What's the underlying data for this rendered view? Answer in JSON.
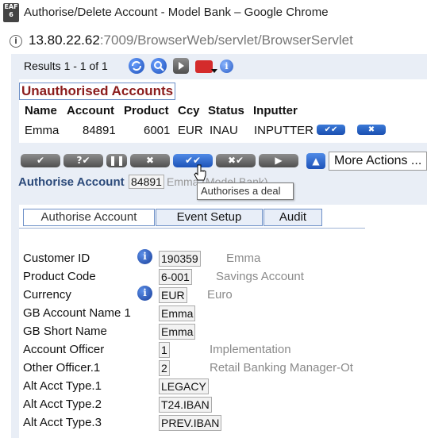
{
  "window": {
    "app_icon_text": [
      "EAF",
      "6"
    ],
    "title": "Authorise/Delete Account - Model Bank – Google Chrome",
    "url_host": "13.80.22.62",
    "url_rest": ":7009/BrowserWeb/servlet/BrowserServlet"
  },
  "toolbar": {
    "results": "Results 1 - 1 of 1"
  },
  "unauthorised": {
    "title": "Unauthorised Accounts",
    "headers": [
      "Name",
      "Account",
      "Product",
      "Ccy",
      "Status",
      "Inputter"
    ],
    "row": [
      "Emma",
      "84891",
      "6001",
      "EUR",
      "INAU",
      "INPUTTER"
    ]
  },
  "actions": {
    "buttons": [
      "✔",
      "?✔",
      "❚❚",
      "✖",
      "✔✔",
      "✖✔",
      "▶"
    ],
    "more_actions": "More Actions ..."
  },
  "record": {
    "label": "Authorise Account",
    "value": "84891",
    "desc": "Emma (Model Bank)",
    "tooltip": "Authorises a deal"
  },
  "tabs": [
    "Authorise Account",
    "Event Setup",
    "Audit"
  ],
  "fields": [
    {
      "label": "Customer ID",
      "value": "190359",
      "desc": "Emma"
    },
    {
      "label": "Product Code",
      "value": "6-001",
      "desc": "Savings Account"
    },
    {
      "label": "Currency",
      "value": "EUR",
      "desc": "Euro"
    },
    {
      "label": "GB Account Name 1",
      "value": "Emma",
      "desc": ""
    },
    {
      "label": "GB Short Name",
      "value": "Emma",
      "desc": ""
    },
    {
      "label": "Account Officer",
      "value": "1",
      "desc": "Implementation"
    },
    {
      "label": "Other Officer.1",
      "value": "2",
      "desc": "Retail Banking Manager-Ot"
    },
    {
      "label": "Alt Acct Type.1",
      "value": "LEGACY",
      "desc": ""
    },
    {
      "label": "Alt Acct Type.2",
      "value": "T24.IBAN",
      "desc": ""
    },
    {
      "label": "Alt Acct Type.3",
      "value": "PREV.IBAN",
      "desc": ""
    }
  ],
  "colors": {
    "accent": "#2c4a7a",
    "title_red": "#8b1c1c",
    "frame": "#e9eef6"
  },
  "icons": [
    "info-icon",
    "refresh-icon",
    "search-icon",
    "next-icon",
    "toolbox-icon",
    "help-icon",
    "up-arrow-icon",
    "cursor-icon"
  ]
}
